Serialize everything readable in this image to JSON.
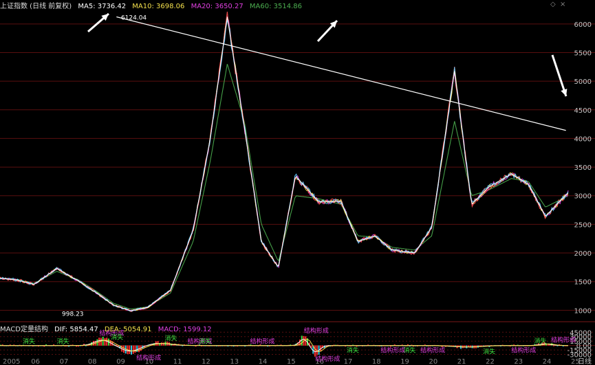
{
  "window": {
    "title": "上证指数 (日线 前复权)",
    "settings_glyph": "◇",
    "close_glyph": "×"
  },
  "colors": {
    "background": "#000000",
    "grid": "#5a0f0f",
    "ma5": "#ffffff",
    "ma10": "#f4e04d",
    "ma20": "#e040e0",
    "ma60": "#4caf50",
    "dif": "#ffffff",
    "dea": "#f4e04d",
    "macd": "#e040e0",
    "bar_up": "#ff3030",
    "bar_down": "#30c8e0",
    "annotation_green": "#40e040",
    "annotation_magenta": "#e040e0",
    "trendline": "#ffffff"
  },
  "main_header": {
    "ma5_label": "MA5:",
    "ma5": "3736.42",
    "ma10_label": "MA10:",
    "ma10": "3698.06",
    "ma20_label": "MA20:",
    "ma20": "3650.27",
    "ma60_label": "MA60:",
    "ma60": "3514.86"
  },
  "macd_header": {
    "name": "MACD定量结构",
    "dif_label": "DIF:",
    "dif": "5854.47",
    "dea_label": "DEA:",
    "dea": "5054.91",
    "macd_label": "MACD:",
    "macd": "1599.12"
  },
  "chart_data": [
    {
      "type": "line",
      "panel": "price",
      "y_ticks": [
        "6000",
        "5500",
        "5000",
        "4500",
        "4000",
        "3500",
        "3000",
        "2500",
        "2000",
        "1500",
        "1000"
      ],
      "ylim": [
        800,
        6250
      ],
      "x": [
        0,
        3,
        6,
        10,
        14,
        17,
        20,
        23,
        26,
        30,
        34,
        37,
        40,
        43,
        46,
        49,
        52,
        56,
        60,
        63,
        66,
        69,
        73,
        76,
        80,
        83,
        86,
        90,
        93,
        96,
        100
      ],
      "series": [
        {
          "name": "MA5",
          "values": [
            1560,
            1530,
            1450,
            1730,
            1500,
            1300,
            1090,
            990,
            1050,
            1350,
            2400,
            4000,
            6124,
            4200,
            2200,
            1750,
            3350,
            2900,
            2900,
            2200,
            2300,
            2050,
            2000,
            2450,
            5178,
            2850,
            3150,
            3380,
            3200,
            2640,
            3050
          ]
        },
        {
          "name": "MA60",
          "values": [
            1550,
            1540,
            1470,
            1680,
            1520,
            1330,
            1120,
            1020,
            1060,
            1300,
            2200,
            3600,
            5300,
            4300,
            2500,
            1850,
            3000,
            2950,
            2850,
            2300,
            2280,
            2100,
            2050,
            2300,
            4300,
            3000,
            3100,
            3300,
            3250,
            2800,
            3000
          ]
        }
      ],
      "annotations": {
        "peak": "6124.04",
        "low": "998.23"
      }
    },
    {
      "type": "bar",
      "panel": "macd",
      "y_ticks": [
        "45000",
        "30000",
        "15000",
        "0.00",
        "-15000",
        "-30000"
      ],
      "ylim": [
        -38000,
        48000
      ],
      "x_ticks": [
        "2005",
        "06",
        "07",
        "08",
        "09",
        "10",
        "11",
        "12",
        "13",
        "14",
        "15",
        "16",
        "17",
        "18",
        "19",
        "20",
        "21",
        "22",
        "23",
        "24",
        "25"
      ],
      "labels": [
        "消失",
        "结构形成"
      ]
    }
  ],
  "axis_label_bottom_right": "日线"
}
